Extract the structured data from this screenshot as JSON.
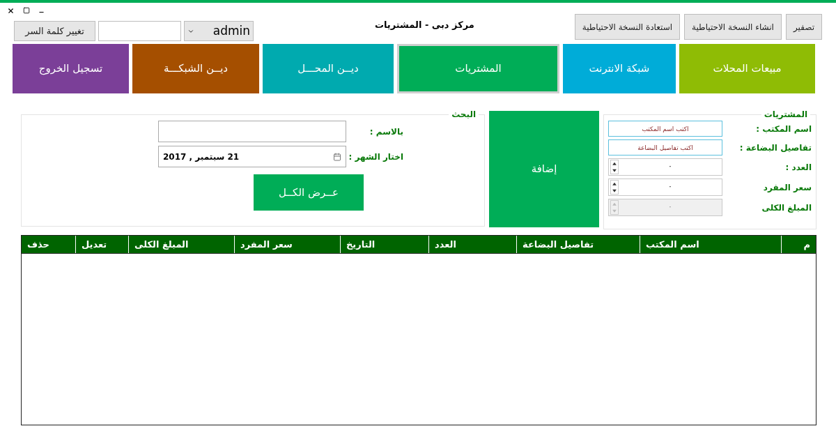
{
  "header": {
    "buttons": [
      "تصفير",
      "انشاء النسخة الاحتياطية",
      "استعادة النسخة الاحتياطية"
    ],
    "title": "مركز دبى - المشتريات",
    "user_select": {
      "value": "admin"
    },
    "change_password_button": "تغيير كلمة السر"
  },
  "nav_tiles": [
    {
      "label": "مبيعات المحلات",
      "color": "#8fbc05",
      "selected": false
    },
    {
      "label": "شبكة الانترنت",
      "color": "#00acd8",
      "selected": false
    },
    {
      "label": "المشتريات",
      "color": "#00ad57",
      "selected": true
    },
    {
      "label": "ديــن المحـــل",
      "color": "#00aaaf",
      "selected": false
    },
    {
      "label": "ديــن الشبكـــة",
      "color": "#a54f00",
      "selected": false
    },
    {
      "label": "تسجيل الخروج",
      "color": "#7b3f98",
      "selected": false
    }
  ],
  "purchases": {
    "title": "المشتريات",
    "fields": [
      {
        "label": "اسم المكتب :",
        "kind": "text",
        "placeholder": "اكتب اسم المكتب"
      },
      {
        "label": "تفاصيل البضاعة :",
        "kind": "text",
        "placeholder": "اكتب تفاصيل البضاعة"
      },
      {
        "label": "العدد :",
        "kind": "spin",
        "value": "٠",
        "disabled": false
      },
      {
        "label": "سعر المفرد",
        "kind": "spin",
        "value": "٠",
        "disabled": false
      },
      {
        "label": "المبلغ الكلى",
        "kind": "spin",
        "value": "٠",
        "disabled": true
      }
    ]
  },
  "add_button": "إضافة",
  "search": {
    "title": "البحث",
    "name_label": "بالاسم :",
    "month_label": "اختار الشهر :",
    "date_value": "21  سبتمبر , 2017",
    "show_all_button": "عــرض الكــل"
  },
  "table": {
    "columns": [
      "م",
      "اسم المكتب",
      "تفاصيل البضاعة",
      "العدد",
      "التاريخ",
      "سعر المفرد",
      "المبلغ الكلى",
      "تعديل",
      "حذف"
    ]
  }
}
